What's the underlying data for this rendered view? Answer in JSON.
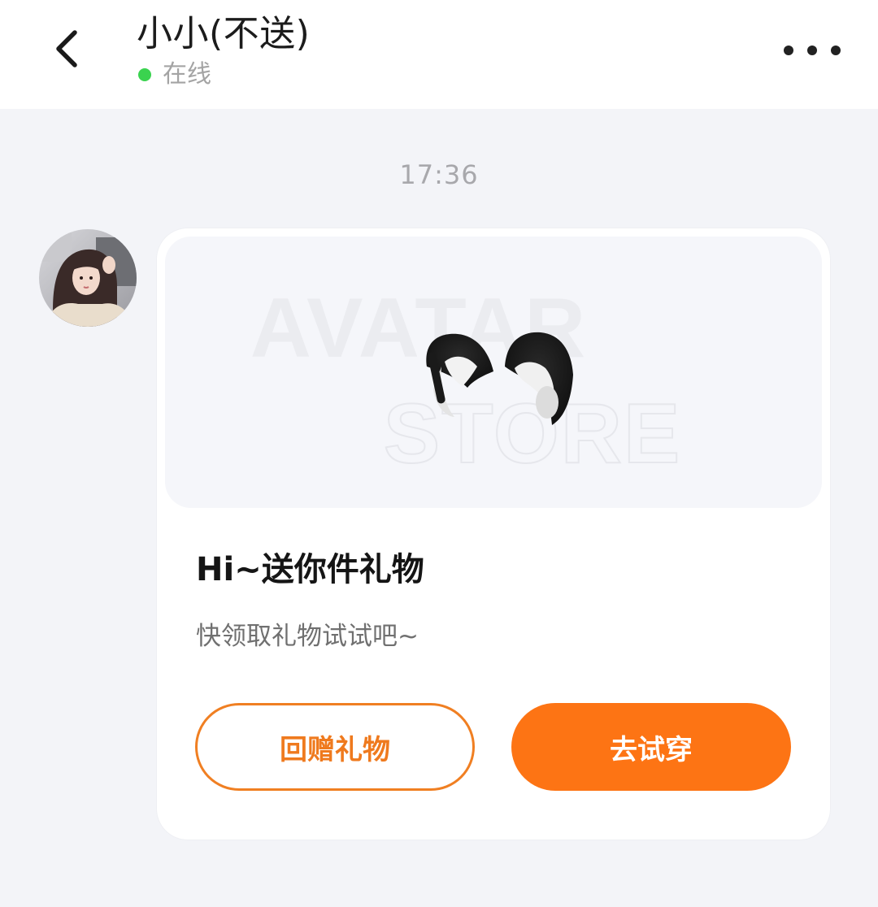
{
  "header": {
    "back_icon": "chevron-left-icon",
    "title": "小小(不送)",
    "status": "在线",
    "status_color": "#3ad34f",
    "more_icon": "more-horizontal-icon"
  },
  "chat": {
    "timestamp": "17:36",
    "message": {
      "sender_avatar": "avatar",
      "card": {
        "watermark_line1": "AVATAR",
        "watermark_line2": "STORE",
        "gift_image": "cat-ears-headband",
        "title": "Hi~送你件礼物",
        "subtitle": "快领取礼物试试吧~",
        "secondary_button": "回赠礼物",
        "primary_button": "去试穿",
        "accent_color": "#fd7414"
      }
    }
  }
}
